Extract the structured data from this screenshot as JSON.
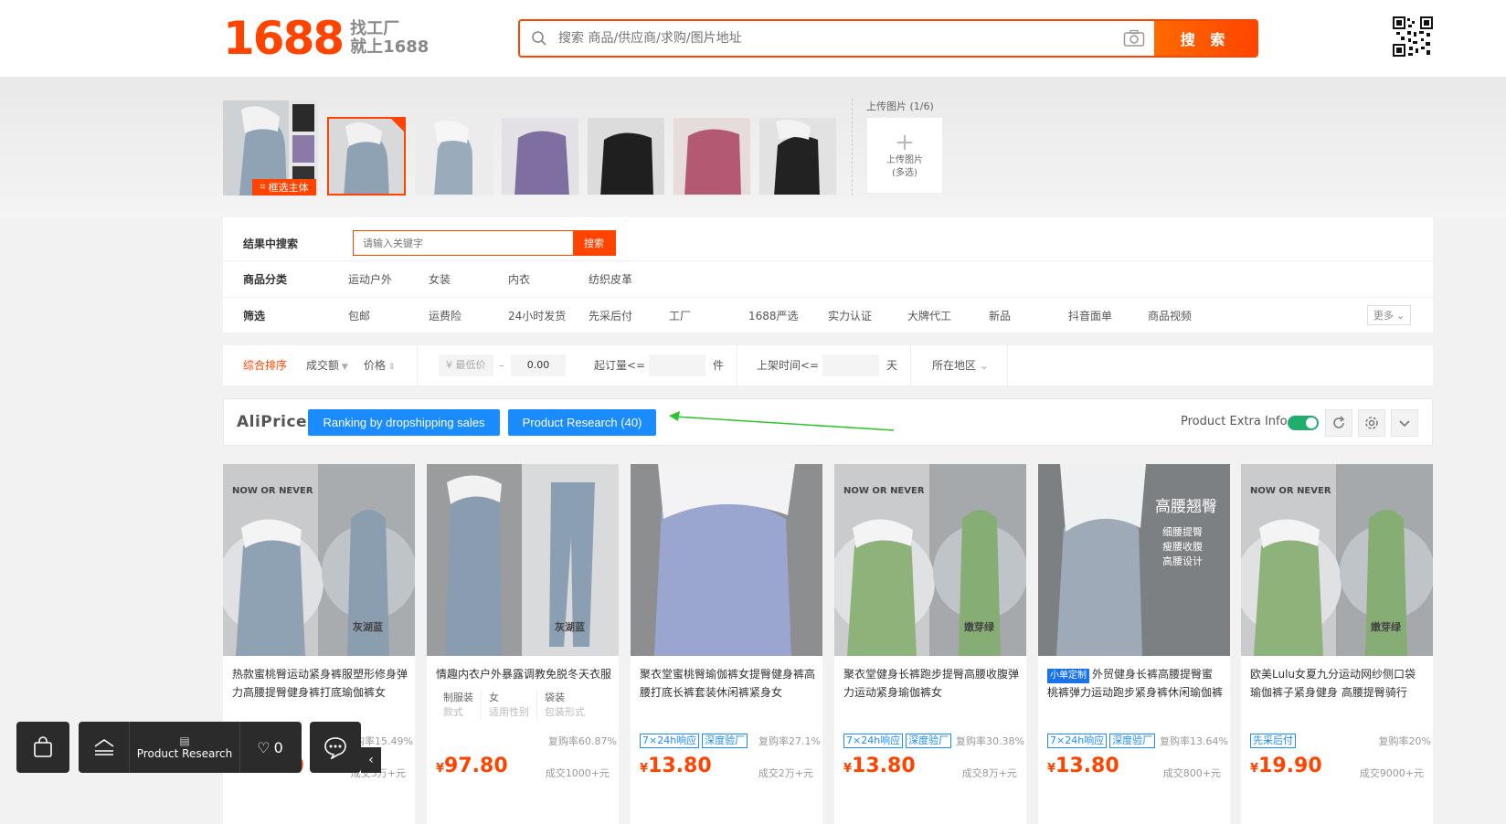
{
  "header": {
    "logo_number": "1688",
    "logo_line1": "找工厂",
    "logo_line2": "就上1688",
    "search_placeholder": "搜索 商品/供应商/求购/图片地址",
    "search_button": "搜 索"
  },
  "image_search": {
    "frame_label": "框选主体",
    "upload_label": "上传图片 (1/6)",
    "upload_box_line1": "上传图片",
    "upload_box_line2": "(多选)"
  },
  "filters": {
    "inner_search_label": "结果中搜索",
    "inner_search_placeholder": "请输入关键字",
    "inner_search_button": "搜索",
    "category_label": "商品分类",
    "categories": [
      "运动户外",
      "女装",
      "内衣",
      "纺织皮革"
    ],
    "filter_label": "筛选",
    "filter_items": [
      "包邮",
      "运费险",
      "24小时发货",
      "先采后付",
      "工厂",
      "1688严选",
      "实力认证",
      "大牌代工",
      "新品",
      "抖音面单",
      "商品视频"
    ],
    "more_label": "更多"
  },
  "sort": {
    "comprehensive": "综合排序",
    "volume": "成交额",
    "price": "价格",
    "min_price_placeholder": "¥ 最低价",
    "dash": "–",
    "max_price_value": "0.00",
    "min_order_label": "起订量<=",
    "min_order_unit": "件",
    "listing_time_label": "上架时间<=",
    "listing_time_unit": "天",
    "region_label": "所在地区"
  },
  "aliprice": {
    "logo": "AliPrice",
    "ranking_button": "Ranking by dropshipping sales",
    "research_button": "Product Research (40)",
    "extra_info_label": "Product Extra Info",
    "extra_info_enabled": true
  },
  "products": [
    {
      "title": "热款蜜桃臀运动紧身裤服塑形修身弹力高腰提臀健身裤打底瑜伽裤女",
      "rebuy": "复购率15.49%",
      "price_int": "12.80",
      "sold": "成交3万+元",
      "img_caption": "灰湖蓝",
      "img_headline": "NOW OR NEVER"
    },
    {
      "title": "情趣内衣户外暴露调教免脱冬天衣服",
      "attrs": [
        {
          "value": "制服装",
          "key": "款式"
        },
        {
          "value": "女",
          "key": "适用性别"
        },
        {
          "value": "袋装",
          "key": "包装形式"
        }
      ],
      "rebuy": "复购率60.87%",
      "price_int": "97.80",
      "sold": "成交1000+元",
      "img_caption": "灰湖蓝"
    },
    {
      "title": "聚衣堂蜜桃臀瑜伽裤女提臀健身裤高腰打底长裤套装休闲裤紧身女",
      "badges": [
        "7×24h响应",
        "深度验厂"
      ],
      "rebuy": "复购率27.1%",
      "price_int": "13.80",
      "sold": "成交2万+元"
    },
    {
      "title": "聚衣堂健身长裤跑步提臀高腰收腹弹力运动紧身瑜伽裤女",
      "badges": [
        "7×24h响应",
        "深度验厂"
      ],
      "rebuy": "复购率30.38%",
      "price_int": "13.80",
      "sold": "成交8万+元",
      "img_caption": "嫩芽绿",
      "img_headline": "NOW OR NEVER"
    },
    {
      "title": "外贸健身长裤高腰提臀蜜桃裤弹力运动跑步紧身裤休闲瑜伽裤小",
      "tag": "小单定制",
      "badges": [
        "7×24h响应",
        "深度验厂"
      ],
      "rebuy": "复购率13.64%",
      "price_int": "13.80",
      "sold": "成交800+元",
      "img_headline": "高腰翘臀",
      "img_points": [
        "细腰提臀",
        "瘦腰收腹",
        "高腰设计"
      ]
    },
    {
      "title": "欧美Lulu女夏九分运动网纱侧口袋瑜伽裤子紧身健身 高腰提臀骑行",
      "badges": [
        "先采后付"
      ],
      "rebuy": "复购率20%",
      "price_int": "19.90",
      "sold": "成交9000+元",
      "img_caption": "嫩芽绿",
      "img_headline": "NOW OR NEVER"
    }
  ],
  "toolbar": {
    "research_label": "Product Research",
    "favorites_count": "0"
  },
  "colors": {
    "brand": "#ff4400",
    "aliprice_blue": "#1a8cff",
    "toggle_green": "#1fae6e"
  }
}
